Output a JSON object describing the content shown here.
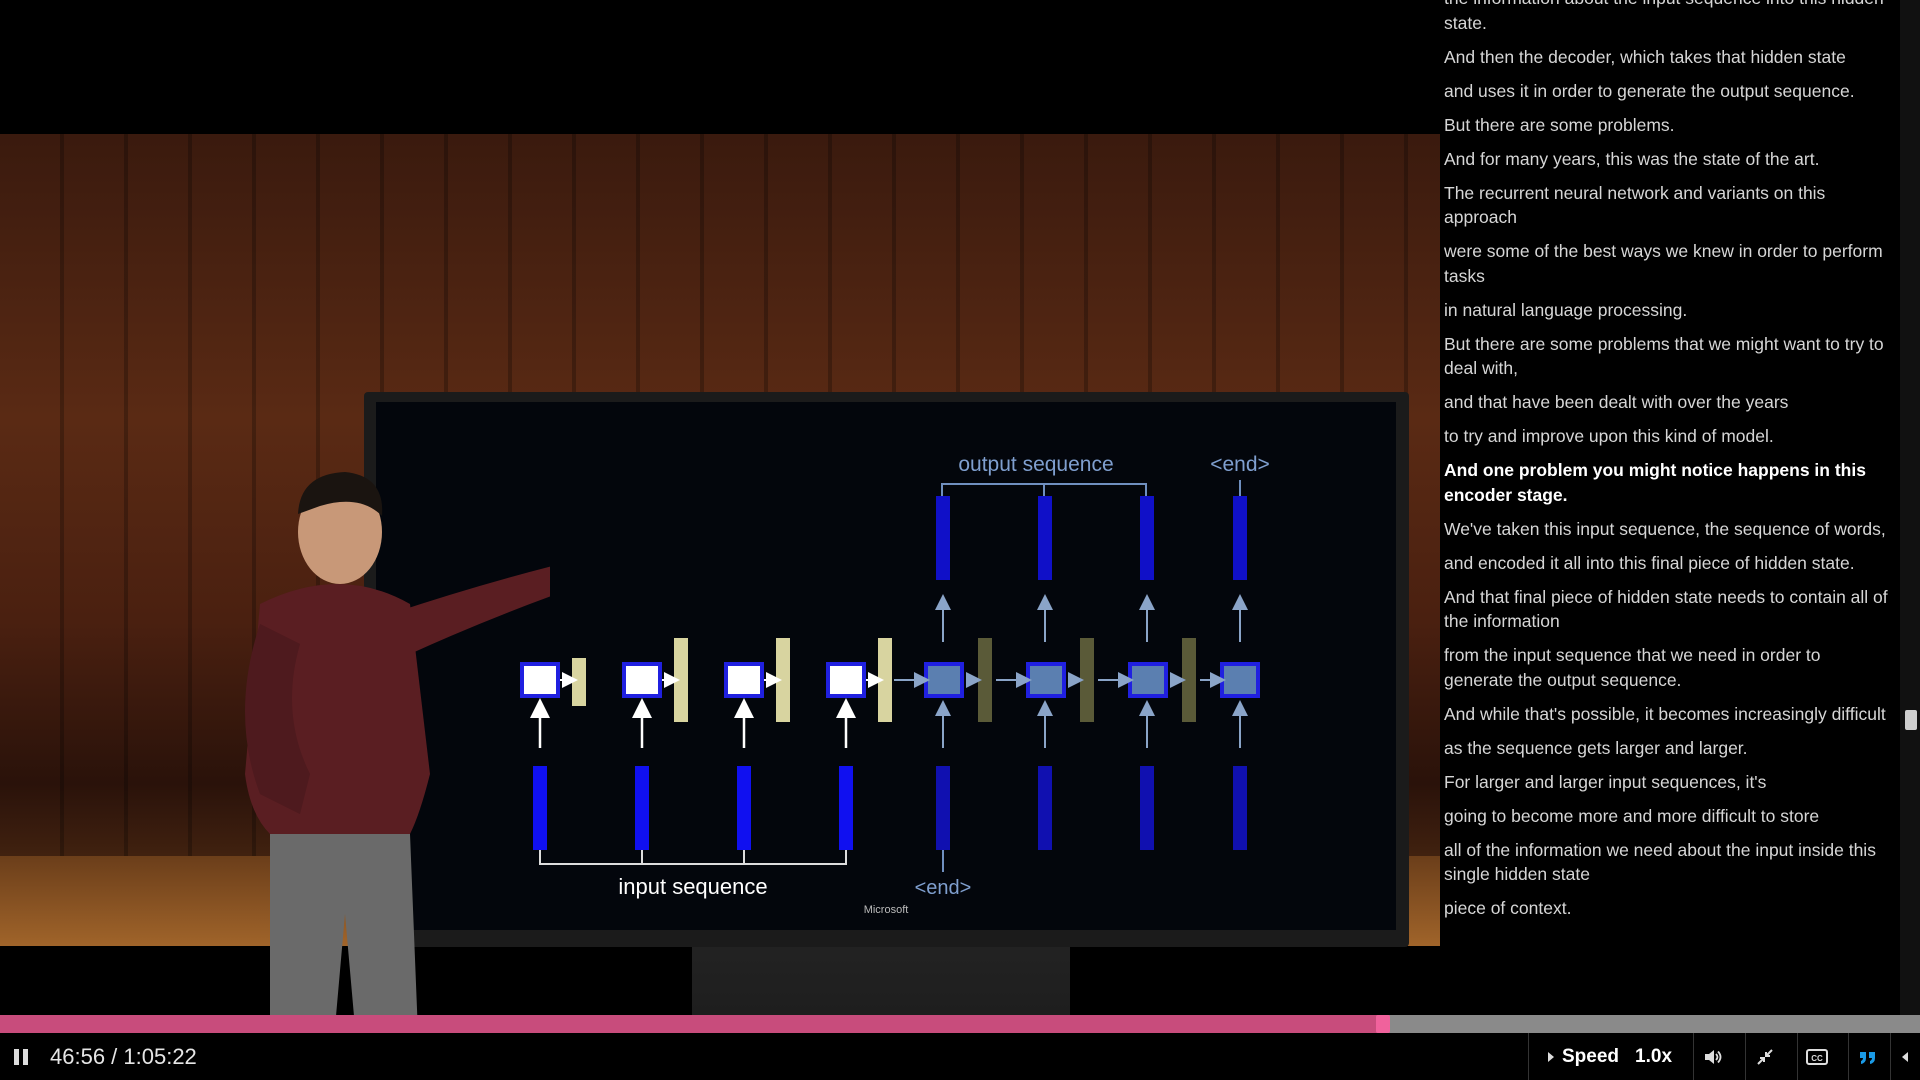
{
  "video": {
    "slide": {
      "output_label": "output sequence",
      "end_top_label": "<end>",
      "input_label": "input sequence",
      "end_bottom_label": "<end>",
      "brand": "Microsoft"
    }
  },
  "transcript": {
    "lines": [
      {
        "text": "the information about the input sequence into this hidden state.",
        "active": false
      },
      {
        "text": "And then the decoder, which takes that hidden state",
        "active": false
      },
      {
        "text": "and uses it in order to generate the output sequence.",
        "active": false
      },
      {
        "text": "But there are some problems.",
        "active": false
      },
      {
        "text": "And for many years, this was the state of the art.",
        "active": false
      },
      {
        "text": "The recurrent neural network and variants on this approach",
        "active": false
      },
      {
        "text": "were some of the best ways we knew in order to perform tasks",
        "active": false
      },
      {
        "text": "in natural language processing.",
        "active": false
      },
      {
        "text": "But there are some problems that we might want to try to deal with,",
        "active": false
      },
      {
        "text": "and that have been dealt with over the years",
        "active": false
      },
      {
        "text": "to try and improve upon this kind of model.",
        "active": false
      },
      {
        "text": "And one problem you might notice happens in this encoder stage.",
        "active": true
      },
      {
        "text": "We've taken this input sequence, the sequence of words,",
        "active": false
      },
      {
        "text": "and encoded it all into this final piece of hidden state.",
        "active": false
      },
      {
        "text": "And that final piece of hidden state needs to contain all of the information",
        "active": false
      },
      {
        "text": "from the input sequence that we need in order to generate the output sequence.",
        "active": false
      },
      {
        "text": "And while that's possible, it becomes increasingly difficult",
        "active": false
      },
      {
        "text": "as the sequence gets larger and larger.",
        "active": false
      },
      {
        "text": "For larger and larger input sequences, it's",
        "active": false
      },
      {
        "text": "going to become more and more difficult to store",
        "active": false
      },
      {
        "text": "all of the information we need about the input inside this single hidden state",
        "active": false
      },
      {
        "text": "piece of context.",
        "active": false
      }
    ]
  },
  "player": {
    "progress_fraction": 0.7205,
    "time_display": "46:56 / 1:05:22",
    "speed_label": "Speed",
    "speed_value": "1.0x",
    "accent_color": "#c84c7c"
  },
  "icons": [
    "pause-icon",
    "volume-icon",
    "fullscreen-exit-icon",
    "closed-captions-icon",
    "transcript-quote-icon",
    "collapse-arrow-icon"
  ]
}
